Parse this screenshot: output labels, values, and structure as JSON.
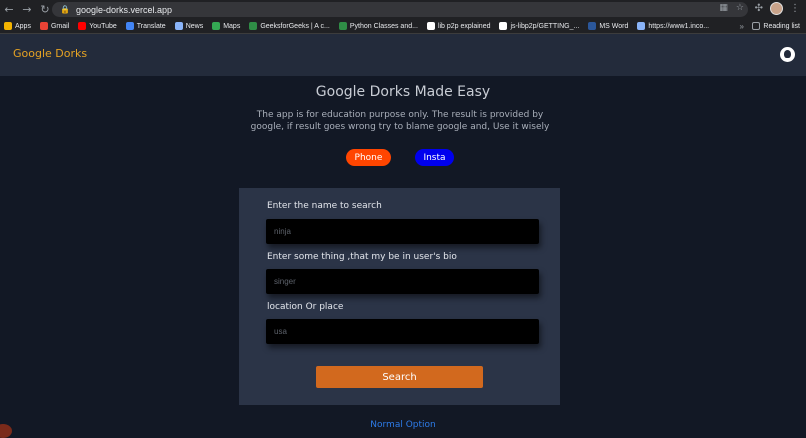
{
  "browser": {
    "url": "google-dorks.vercel.app",
    "bookmarks": [
      {
        "label": "Apps",
        "icon": "apps-grid-icon",
        "color": "#f4b400"
      },
      {
        "label": "Gmail",
        "icon": "gmail-icon",
        "color": "#ea4335"
      },
      {
        "label": "YouTube",
        "icon": "youtube-icon",
        "color": "#ff0000"
      },
      {
        "label": "Translate",
        "icon": "translate-icon",
        "color": "#4285f4"
      },
      {
        "label": "News",
        "icon": "news-icon",
        "color": "#8ab4f8"
      },
      {
        "label": "Maps",
        "icon": "maps-icon",
        "color": "#34a853"
      },
      {
        "label": "GeeksforGeeks | A c...",
        "icon": "geeksforgeeks-icon",
        "color": "#2f8d46"
      },
      {
        "label": "Python Classes and...",
        "icon": "geeksforgeeks-icon",
        "color": "#2f8d46"
      },
      {
        "label": "lib p2p explained",
        "icon": "link-icon",
        "color": "#ffffff"
      },
      {
        "label": "js-libp2p/GETTING_...",
        "icon": "github-icon",
        "color": "#ffffff"
      },
      {
        "label": "MS Word",
        "icon": "ms-word-icon",
        "color": "#2b579a"
      },
      {
        "label": "https://www1.inco...",
        "icon": "globe-icon",
        "color": "#8ab4f8"
      }
    ],
    "reading_list": "Reading list"
  },
  "navbar": {
    "brand": "Google Dorks",
    "brand_color": "#e6a324"
  },
  "hero": {
    "title": "Google Dorks Made Easy",
    "description": "The app is for education purpose only. The result is provided by google, if result goes wrong try to blame google and, Use it wisely"
  },
  "mode_buttons": {
    "phone": {
      "label": "Phone",
      "color": "#ff4500"
    },
    "insta": {
      "label": "Insta",
      "color": "#0000ee"
    }
  },
  "form": {
    "name_label": "Enter the name to search",
    "name_placeholder": "ninja",
    "bio_label": "Enter some thing ,that my be in user's bio",
    "bio_placeholder": "singer",
    "location_label": "location Or place",
    "location_placeholder": "usa",
    "search_label": "Search",
    "search_color": "#d2691e"
  },
  "footer": {
    "normal_option": "Normal Option"
  }
}
